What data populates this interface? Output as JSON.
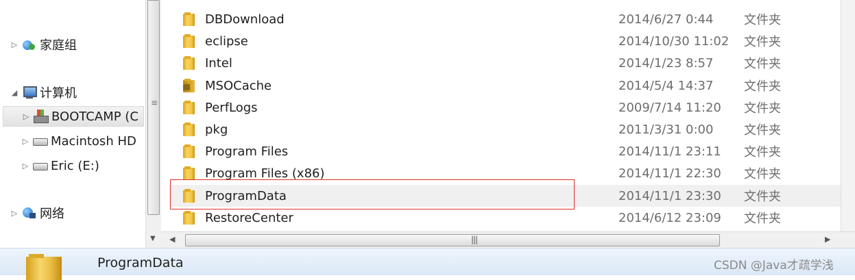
{
  "nav": {
    "items": [
      {
        "label": "家庭组"
      },
      {
        "label": "计算机"
      },
      {
        "label": "BOOTCAMP (C"
      },
      {
        "label": "Macintosh HD"
      },
      {
        "label": "Eric (E:)"
      },
      {
        "label": "网络"
      }
    ]
  },
  "files": [
    {
      "name": "DBDownload",
      "date": "2014/6/27 0:44",
      "type": "文件夹"
    },
    {
      "name": "eclipse",
      "date": "2014/10/30 11:02",
      "type": "文件夹"
    },
    {
      "name": "Intel",
      "date": "2014/1/23 8:57",
      "type": "文件夹"
    },
    {
      "name": "MSOCache",
      "date": "2014/5/4 14:37",
      "type": "文件夹"
    },
    {
      "name": "PerfLogs",
      "date": "2009/7/14 11:20",
      "type": "文件夹"
    },
    {
      "name": "pkg",
      "date": "2011/3/31 0:00",
      "type": "文件夹"
    },
    {
      "name": "Program Files",
      "date": "2014/11/1 23:11",
      "type": "文件夹"
    },
    {
      "name": "Program Files (x86)",
      "date": "2014/11/1 22:30",
      "type": "文件夹"
    },
    {
      "name": "ProgramData",
      "date": "2014/11/1 23:30",
      "type": "文件夹"
    },
    {
      "name": "RestoreCenter",
      "date": "2014/6/12 23:09",
      "type": "文件夹"
    }
  ],
  "status": {
    "selected_name": "ProgramData"
  },
  "watermark": "CSDN @Java才疏学浅",
  "colors": {
    "highlight_box": "#e0302a",
    "status_bar": "#dbe8f6"
  }
}
